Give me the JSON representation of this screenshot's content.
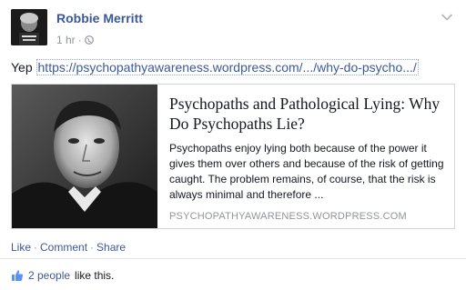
{
  "post": {
    "author": "Robbie Merritt",
    "time": "1 hr",
    "text": "Yep",
    "link_text": "https://psychopathyawareness.wordpress.com/.../why-do-psycho.../",
    "icons": {
      "audience": "globe-icon",
      "options": "chevron-down-icon",
      "like": "thumbs-up-icon"
    }
  },
  "card": {
    "title": "Psychopaths and Pathological Lying: Why Do Psychopaths Lie?",
    "description": "Psychopaths enjoy lying both because of the power it gives them over others and because of the risk of getting caught. The problem remains, of course, that the risk is always minimal and therefore ...",
    "domain": "PSYCHOPATHYAWARENESS.WORDPRESS.COM"
  },
  "actions": {
    "like": "Like",
    "comment": "Comment",
    "share": "Share"
  },
  "likes": {
    "count": "2 people",
    "suffix": "like this."
  },
  "colors": {
    "link": "#3b5998",
    "text": "#141823",
    "muted": "#90949c",
    "border": "#d3d6db"
  }
}
